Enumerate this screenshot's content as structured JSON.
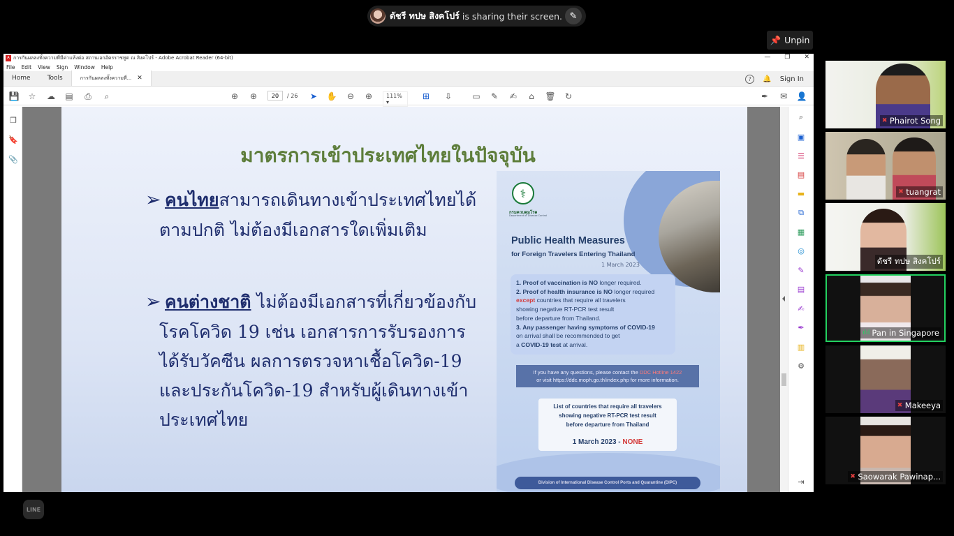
{
  "share_banner": {
    "presenter": "ดัชรี ทปษ สิงคโปร์",
    "suffix": "is sharing their screen."
  },
  "unpin_label": "Unpin",
  "acrobat": {
    "window_title": "การกันผลลงทั้งความที่มีค่าแห้งต่อ สถานเอกอัครราชทูต ณ สิงคโปร์ - Adobe Acrobat Reader (64-bit)",
    "menu": [
      "File",
      "Edit",
      "View",
      "Sign",
      "Window",
      "Help"
    ],
    "tabs": [
      "Home",
      "Tools"
    ],
    "doc_tab": "การกันผลลงทั้งความที่...",
    "sign_in": "Sign In",
    "page_current": "20",
    "page_total": "/ 26",
    "zoom": "111%"
  },
  "slide": {
    "title": "มาตรการเข้าประเทศไทยในปัจจุบัน",
    "bullet1_kw": "คนไทย",
    "bullet1_line1": "สามารถเดินทางเข้าประเทศไทยได้",
    "bullet1_line2": "ตามปกติ ไม่ต้องมีเอกสารใดเพิ่มเติม",
    "bullet2_kw": "คนต่างชาติ",
    "bullet2_line1": " ไม่ต้องมีเอกสารที่เกี่ยวข้องกับ",
    "bullet2_line2": "โรคโควิด 19 เช่น เอกสารการรับรองการ",
    "bullet2_line3": "ได้รับวัคซีน ผลการตรวจหาเชื้อโควิด-19",
    "bullet2_line4": "และประกันโควิด-19 สำหรับผู้เดินทางเข้า",
    "bullet2_line5": "ประเทศไทย"
  },
  "poster": {
    "org": "กรมควบคุมโรค",
    "org_en": "Department of Disease Control",
    "title": "Public Health Measures",
    "subtitle": "for Foreign Travelers Entering Thailand",
    "date": "1 March 2023",
    "item1_a": "1. Proof of vaccination is ",
    "item1_b": "NO",
    "item1_c": " longer required.",
    "item2_a": "2. Proof of health insurance is ",
    "item2_b": "NO",
    "item2_c": " longer required",
    "item2_d": "except",
    "item2_e": " countries that require all travelers",
    "item2_f": "showing negative RT-PCR test result",
    "item2_g": "before departure from Thailand.",
    "item3_a": "3. Any passenger having symptoms of COVID-19",
    "item3_b": "on arrival shall be recommended to get",
    "item3_c": "a ",
    "item3_d": "COVID-19 test",
    "item3_e": " at arrival.",
    "contact_a": "If you have any questions, please contact the ",
    "contact_b": "DDC Hotline 1422",
    "contact_c": "or visit https://ddc.moph.go.th/index.php for more information.",
    "list_line1": "List of countries that require all travelers",
    "list_line2": "showing negative RT-PCR test result",
    "list_line3": "before departure from Thailand",
    "list_date": "1 March 2023 - ",
    "list_none": "NONE",
    "footer": "Division of International Disease Control Ports and Quarantine (DIPC)"
  },
  "participants": [
    {
      "name": "Phairot Song",
      "muted": true
    },
    {
      "name": "tuangrat",
      "muted": true
    },
    {
      "name": "ดัชรี ทปษ สิงคโปร์",
      "muted": false
    },
    {
      "name": "Pan in Singapore",
      "muted": false,
      "speaking": true
    },
    {
      "name": "Makeeya",
      "muted": true
    },
    {
      "name": "Saowarak Pawinap...",
      "muted": true
    }
  ],
  "line_logo": "LINE",
  "colors": {
    "active_speaker": "#23d160",
    "slide_title": "#5d7d3a",
    "slide_text": "#1f2e6e",
    "poster_red": "#d43a3a"
  }
}
